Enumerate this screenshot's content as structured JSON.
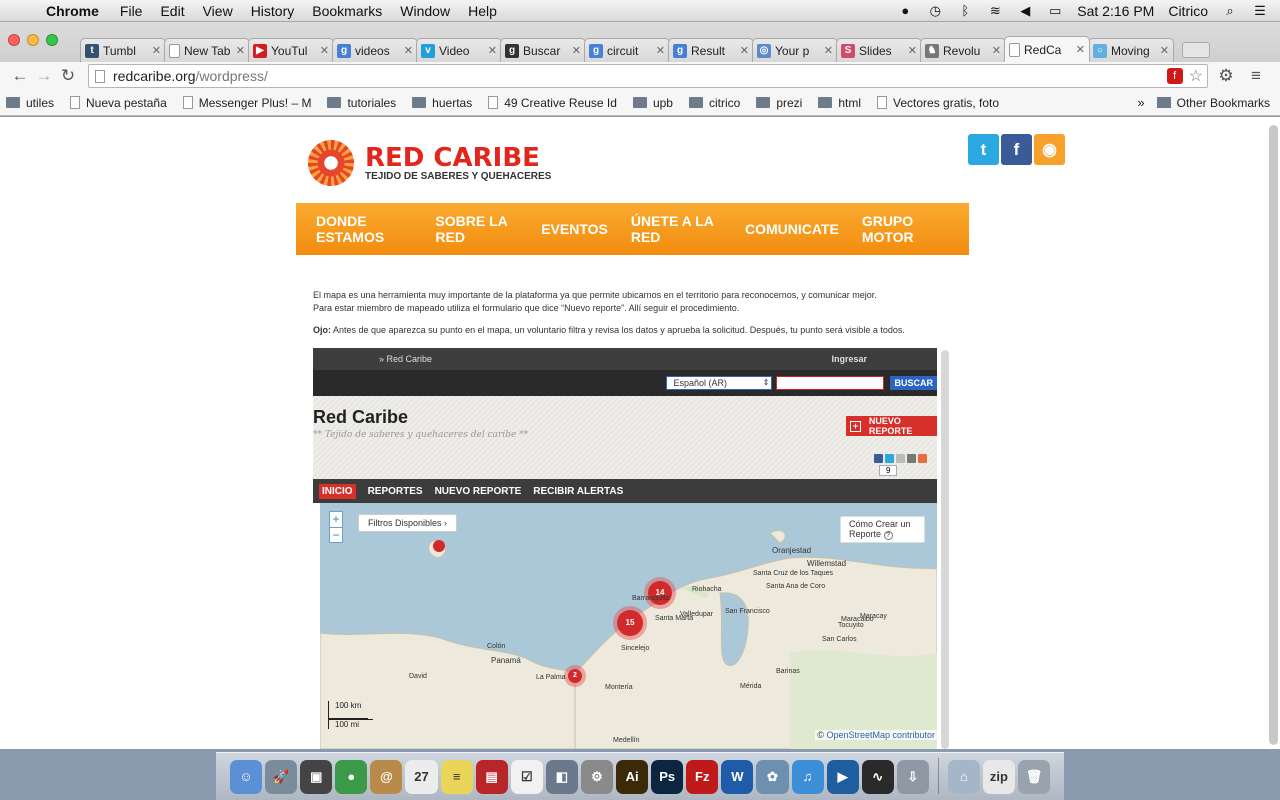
{
  "menubar": {
    "app": "Chrome",
    "items": [
      "File",
      "Edit",
      "View",
      "History",
      "Bookmarks",
      "Window",
      "Help"
    ],
    "clock": "Sat 2:16 PM",
    "user": "Citrico"
  },
  "tabs": [
    {
      "label": "Tumbl",
      "color": "#34526f",
      "glyph": "t"
    },
    {
      "label": "New Tab",
      "color": "",
      "glyph": ""
    },
    {
      "label": "YouTul",
      "color": "#d21e1e",
      "glyph": "▶"
    },
    {
      "label": "videos",
      "color": "#4a7fd6",
      "glyph": "g"
    },
    {
      "label": "Video",
      "color": "#1fa0d8",
      "glyph": "v"
    },
    {
      "label": "Buscar",
      "color": "#333333",
      "glyph": "g"
    },
    {
      "label": "circuit",
      "color": "#4a7fd6",
      "glyph": "g"
    },
    {
      "label": "Result",
      "color": "#4a7fd6",
      "glyph": "g"
    },
    {
      "label": "Your p",
      "color": "#5b8cc9",
      "glyph": "◎"
    },
    {
      "label": "Slides",
      "color": "#d44a6a",
      "glyph": "S"
    },
    {
      "label": "Revolu",
      "color": "#777777",
      "glyph": "♞"
    },
    {
      "label": "RedCa",
      "color": "",
      "glyph": ""
    },
    {
      "label": "Moving",
      "color": "#5db0e0",
      "glyph": "○"
    }
  ],
  "active_tab_index": 11,
  "address": {
    "host": "redcaribe.org",
    "path": "/wordpress/"
  },
  "bookmarks": [
    {
      "label": "utiles",
      "type": "folder"
    },
    {
      "label": "Nueva pestaña",
      "type": "page"
    },
    {
      "label": "Messenger Plus! – M",
      "type": "page"
    },
    {
      "label": "tutoriales",
      "type": "folder"
    },
    {
      "label": "huertas",
      "type": "folder"
    },
    {
      "label": "49 Creative Reuse Id",
      "type": "page"
    },
    {
      "label": "upb",
      "type": "folder"
    },
    {
      "label": "citrico",
      "type": "folder"
    },
    {
      "label": "prezi",
      "type": "folder"
    },
    {
      "label": "html",
      "type": "folder"
    },
    {
      "label": "Vectores gratis, foto",
      "type": "page"
    }
  ],
  "bookmarks_overflow": "»",
  "other_bookmarks": "Other Bookmarks",
  "site": {
    "logo_title": "RED CARIBE",
    "logo_subtitle": "TEJIDO DE SABERES Y QUEHACERES",
    "nav": [
      "DONDE ESTAMOS",
      "SOBRE LA RED",
      "EVENTOS",
      "ÚNETE A LA RED",
      "COMUNICATE",
      "GRUPO MOTOR"
    ],
    "intro_line1": "El mapa es una herramienta muy importante de la plataforma ya que permite ubicarnos en el territorio para reconocernos, y comunicar mejor.",
    "intro_line2": "Para estar miembro de mapeado utiliza el formulario que dice “Nuevo reporte”. Allí seguir el procedimiento.",
    "note_label": "Ojo:",
    "note_text": " Antes de que aparezca su punto en el mapa, un voluntario filtra y revisa los datos y aprueba la solicitud. Después, tu punto será visible a todos."
  },
  "embed": {
    "crumb": "»   Red Caribe",
    "login": "Ingresar",
    "language": "Español (AR)",
    "search_button": "BUSCAR",
    "title": "Red Caribe",
    "subtitle": "** Tejido de saberes y quehaceres del caribe **",
    "new_report": "NUEVO REPORTE",
    "share_count": "9",
    "tabs": [
      "INICIO",
      "REPORTES",
      "NUEVO REPORTE",
      "RECIBIR ALERTAS"
    ],
    "filters": "Filtros Disponibles ›",
    "how_to": "Cómo Crear un Reporte",
    "clusters": [
      "14",
      "15",
      "2"
    ],
    "scale_km": "100 km",
    "scale_mi": "100 mi",
    "attribution_prefix": "©",
    "attribution_link": "OpenStreetMap contributor",
    "labels": [
      "Oranjestad",
      "Willemstad",
      "Panamá",
      "Colón",
      "David",
      "La Palma",
      "Sincelejo",
      "Montería",
      "Medellín",
      "Maracaibo",
      "Valledupar",
      "Barranquilla",
      "Santa Marta",
      "Riohacha",
      "San Francisco",
      "Santa Cruz de los Taques",
      "Santa Ana de Coro",
      "Tocuyito",
      "San Carlos",
      "Maracay",
      "Barinas",
      "Mérida"
    ]
  },
  "dock": [
    {
      "name": "finder",
      "color": "#5b8fd6",
      "glyph": "☺"
    },
    {
      "name": "launchpad",
      "color": "#7a8b9c",
      "glyph": "🚀"
    },
    {
      "name": "photo-booth",
      "color": "#444",
      "glyph": "▣"
    },
    {
      "name": "chrome",
      "color": "#3b9a47",
      "glyph": "●"
    },
    {
      "name": "mail",
      "color": "#b98b4a",
      "glyph": "@"
    },
    {
      "name": "calendar",
      "color": "#ececec",
      "glyph": "27"
    },
    {
      "name": "stickies",
      "color": "#e9d55a",
      "glyph": "≡"
    },
    {
      "name": "photo-booth-red",
      "color": "#b8262a",
      "glyph": "▤"
    },
    {
      "name": "reminders",
      "color": "#f1f1f1",
      "glyph": "☑"
    },
    {
      "name": "preview",
      "color": "#6a7a8c",
      "glyph": "◧"
    },
    {
      "name": "system-prefs",
      "color": "#8a8a8a",
      "glyph": "⚙"
    },
    {
      "name": "illustrator",
      "color": "#3a2a08",
      "glyph": "Ai"
    },
    {
      "name": "photoshop",
      "color": "#0c2540",
      "glyph": "Ps"
    },
    {
      "name": "filezilla",
      "color": "#bf1a1a",
      "glyph": "Fz"
    },
    {
      "name": "word",
      "color": "#1f5ba8",
      "glyph": "W"
    },
    {
      "name": "iphoto",
      "color": "#6d8fb0",
      "glyph": "✿"
    },
    {
      "name": "itunes",
      "color": "#3c8fd6",
      "glyph": "♫"
    },
    {
      "name": "quicktime",
      "color": "#1e5e9e",
      "glyph": "▶"
    },
    {
      "name": "activity-monitor",
      "color": "#2a2a2a",
      "glyph": "∿"
    },
    {
      "name": "installer",
      "color": "#8f98a4",
      "glyph": "⇩"
    },
    {
      "name": "downloads",
      "color": "#a4b6c8",
      "glyph": "⌂"
    },
    {
      "name": "zip-file",
      "color": "#e8e8e8",
      "glyph": "zip"
    },
    {
      "name": "trash",
      "color": "#9aa3ad",
      "glyph": "🗑"
    }
  ]
}
